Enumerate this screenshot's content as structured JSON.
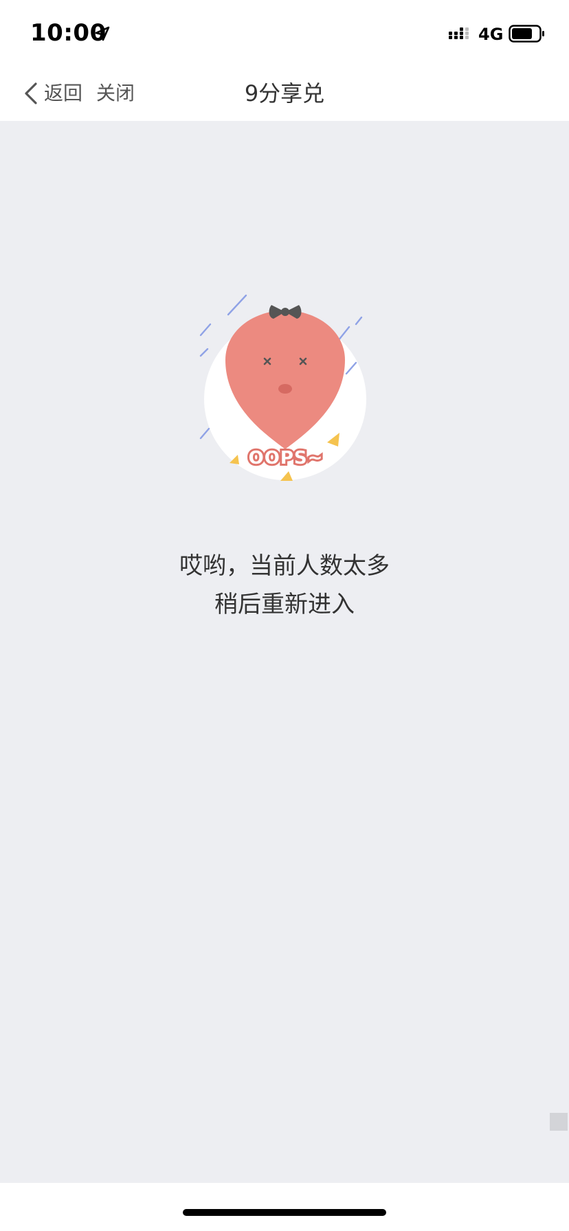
{
  "status_bar": {
    "time": "10:00",
    "network": "4G",
    "icons": {
      "location": "location-arrow-icon",
      "signal": "signal-bars-icon",
      "battery": "battery-icon"
    }
  },
  "nav": {
    "back_label": "返回",
    "close_label": "关闭",
    "title": "9分享兑"
  },
  "main": {
    "illustration_text": "OOPS~",
    "message_line1": "哎哟，当前人数太多",
    "message_line2": "稍后重新进入"
  },
  "colors": {
    "page_background": "#edeef2",
    "balloon": "#ec8a80",
    "bow": "#555555",
    "rain": "#8fa2e6",
    "sparkle": "#f5c34f"
  }
}
